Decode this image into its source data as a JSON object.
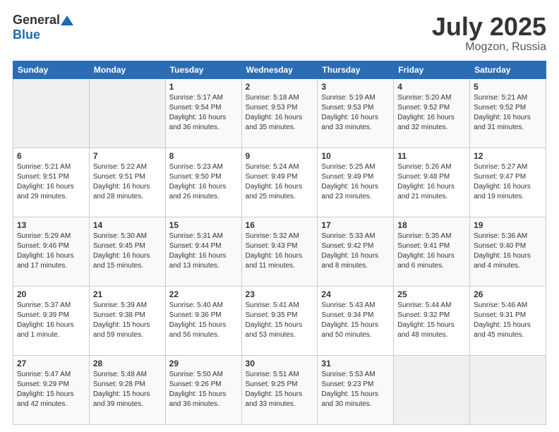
{
  "logo": {
    "general": "General",
    "blue": "Blue"
  },
  "title": {
    "month_year": "July 2025",
    "location": "Mogzon, Russia"
  },
  "headers": [
    "Sunday",
    "Monday",
    "Tuesday",
    "Wednesday",
    "Thursday",
    "Friday",
    "Saturday"
  ],
  "weeks": [
    [
      {
        "day": "",
        "sunrise": "",
        "sunset": "",
        "daylight": ""
      },
      {
        "day": "",
        "sunrise": "",
        "sunset": "",
        "daylight": ""
      },
      {
        "day": "1",
        "sunrise": "Sunrise: 5:17 AM",
        "sunset": "Sunset: 9:54 PM",
        "daylight": "Daylight: 16 hours and 36 minutes."
      },
      {
        "day": "2",
        "sunrise": "Sunrise: 5:18 AM",
        "sunset": "Sunset: 9:53 PM",
        "daylight": "Daylight: 16 hours and 35 minutes."
      },
      {
        "day": "3",
        "sunrise": "Sunrise: 5:19 AM",
        "sunset": "Sunset: 9:53 PM",
        "daylight": "Daylight: 16 hours and 33 minutes."
      },
      {
        "day": "4",
        "sunrise": "Sunrise: 5:20 AM",
        "sunset": "Sunset: 9:52 PM",
        "daylight": "Daylight: 16 hours and 32 minutes."
      },
      {
        "day": "5",
        "sunrise": "Sunrise: 5:21 AM",
        "sunset": "Sunset: 9:52 PM",
        "daylight": "Daylight: 16 hours and 31 minutes."
      }
    ],
    [
      {
        "day": "6",
        "sunrise": "Sunrise: 5:21 AM",
        "sunset": "Sunset: 9:51 PM",
        "daylight": "Daylight: 16 hours and 29 minutes."
      },
      {
        "day": "7",
        "sunrise": "Sunrise: 5:22 AM",
        "sunset": "Sunset: 9:51 PM",
        "daylight": "Daylight: 16 hours and 28 minutes."
      },
      {
        "day": "8",
        "sunrise": "Sunrise: 5:23 AM",
        "sunset": "Sunset: 9:50 PM",
        "daylight": "Daylight: 16 hours and 26 minutes."
      },
      {
        "day": "9",
        "sunrise": "Sunrise: 5:24 AM",
        "sunset": "Sunset: 9:49 PM",
        "daylight": "Daylight: 16 hours and 25 minutes."
      },
      {
        "day": "10",
        "sunrise": "Sunrise: 5:25 AM",
        "sunset": "Sunset: 9:49 PM",
        "daylight": "Daylight: 16 hours and 23 minutes."
      },
      {
        "day": "11",
        "sunrise": "Sunrise: 5:26 AM",
        "sunset": "Sunset: 9:48 PM",
        "daylight": "Daylight: 16 hours and 21 minutes."
      },
      {
        "day": "12",
        "sunrise": "Sunrise: 5:27 AM",
        "sunset": "Sunset: 9:47 PM",
        "daylight": "Daylight: 16 hours and 19 minutes."
      }
    ],
    [
      {
        "day": "13",
        "sunrise": "Sunrise: 5:29 AM",
        "sunset": "Sunset: 9:46 PM",
        "daylight": "Daylight: 16 hours and 17 minutes."
      },
      {
        "day": "14",
        "sunrise": "Sunrise: 5:30 AM",
        "sunset": "Sunset: 9:45 PM",
        "daylight": "Daylight: 16 hours and 15 minutes."
      },
      {
        "day": "15",
        "sunrise": "Sunrise: 5:31 AM",
        "sunset": "Sunset: 9:44 PM",
        "daylight": "Daylight: 16 hours and 13 minutes."
      },
      {
        "day": "16",
        "sunrise": "Sunrise: 5:32 AM",
        "sunset": "Sunset: 9:43 PM",
        "daylight": "Daylight: 16 hours and 11 minutes."
      },
      {
        "day": "17",
        "sunrise": "Sunrise: 5:33 AM",
        "sunset": "Sunset: 9:42 PM",
        "daylight": "Daylight: 16 hours and 8 minutes."
      },
      {
        "day": "18",
        "sunrise": "Sunrise: 5:35 AM",
        "sunset": "Sunset: 9:41 PM",
        "daylight": "Daylight: 16 hours and 6 minutes."
      },
      {
        "day": "19",
        "sunrise": "Sunrise: 5:36 AM",
        "sunset": "Sunset: 9:40 PM",
        "daylight": "Daylight: 16 hours and 4 minutes."
      }
    ],
    [
      {
        "day": "20",
        "sunrise": "Sunrise: 5:37 AM",
        "sunset": "Sunset: 9:39 PM",
        "daylight": "Daylight: 16 hours and 1 minute."
      },
      {
        "day": "21",
        "sunrise": "Sunrise: 5:39 AM",
        "sunset": "Sunset: 9:38 PM",
        "daylight": "Daylight: 15 hours and 59 minutes."
      },
      {
        "day": "22",
        "sunrise": "Sunrise: 5:40 AM",
        "sunset": "Sunset: 9:36 PM",
        "daylight": "Daylight: 15 hours and 56 minutes."
      },
      {
        "day": "23",
        "sunrise": "Sunrise: 5:41 AM",
        "sunset": "Sunset: 9:35 PM",
        "daylight": "Daylight: 15 hours and 53 minutes."
      },
      {
        "day": "24",
        "sunrise": "Sunrise: 5:43 AM",
        "sunset": "Sunset: 9:34 PM",
        "daylight": "Daylight: 15 hours and 50 minutes."
      },
      {
        "day": "25",
        "sunrise": "Sunrise: 5:44 AM",
        "sunset": "Sunset: 9:32 PM",
        "daylight": "Daylight: 15 hours and 48 minutes."
      },
      {
        "day": "26",
        "sunrise": "Sunrise: 5:46 AM",
        "sunset": "Sunset: 9:31 PM",
        "daylight": "Daylight: 15 hours and 45 minutes."
      }
    ],
    [
      {
        "day": "27",
        "sunrise": "Sunrise: 5:47 AM",
        "sunset": "Sunset: 9:29 PM",
        "daylight": "Daylight: 15 hours and 42 minutes."
      },
      {
        "day": "28",
        "sunrise": "Sunrise: 5:48 AM",
        "sunset": "Sunset: 9:28 PM",
        "daylight": "Daylight: 15 hours and 39 minutes."
      },
      {
        "day": "29",
        "sunrise": "Sunrise: 5:50 AM",
        "sunset": "Sunset: 9:26 PM",
        "daylight": "Daylight: 15 hours and 36 minutes."
      },
      {
        "day": "30",
        "sunrise": "Sunrise: 5:51 AM",
        "sunset": "Sunset: 9:25 PM",
        "daylight": "Daylight: 15 hours and 33 minutes."
      },
      {
        "day": "31",
        "sunrise": "Sunrise: 5:53 AM",
        "sunset": "Sunset: 9:23 PM",
        "daylight": "Daylight: 15 hours and 30 minutes."
      },
      {
        "day": "",
        "sunrise": "",
        "sunset": "",
        "daylight": ""
      },
      {
        "day": "",
        "sunrise": "",
        "sunset": "",
        "daylight": ""
      }
    ]
  ]
}
